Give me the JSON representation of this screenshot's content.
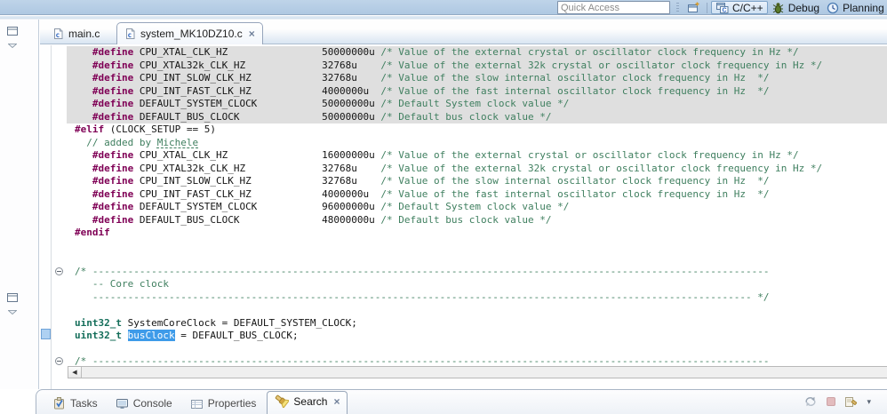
{
  "toolbar": {
    "quick_access": {
      "placeholder": "Quick Access"
    },
    "perspective_buttons": [
      {
        "label": "C/C++",
        "active": true
      },
      {
        "label": "Debug",
        "active": false
      },
      {
        "label": "Planning",
        "active": false
      }
    ]
  },
  "editor_tabs": {
    "items": [
      {
        "label": "main.c",
        "active": false
      },
      {
        "label": "system_MK10DZ10.c",
        "active": true,
        "close": "×"
      }
    ]
  },
  "editor": {
    "lines": [
      {
        "row": 0,
        "inactive": true,
        "t": [
          [
            "p",
            "   "
          ],
          [
            "k",
            "#define"
          ],
          [
            "p",
            " CPU_XTAL_CLK_HZ                50000000u "
          ],
          [
            "c",
            "/* Value of the external crystal or oscillator clock frequency in Hz */"
          ]
        ]
      },
      {
        "row": 1,
        "inactive": true,
        "t": [
          [
            "p",
            "   "
          ],
          [
            "k",
            "#define"
          ],
          [
            "p",
            " CPU_XTAL32k_CLK_HZ             32768u    "
          ],
          [
            "c",
            "/* Value of the external 32k crystal or oscillator clock frequency in Hz */"
          ]
        ]
      },
      {
        "row": 2,
        "inactive": true,
        "t": [
          [
            "p",
            "   "
          ],
          [
            "k",
            "#define"
          ],
          [
            "p",
            " CPU_INT_SLOW_CLK_HZ            32768u    "
          ],
          [
            "c",
            "/* Value of the slow internal oscillator clock frequency in Hz  */"
          ]
        ]
      },
      {
        "row": 3,
        "inactive": true,
        "t": [
          [
            "p",
            "   "
          ],
          [
            "k",
            "#define"
          ],
          [
            "p",
            " CPU_INT_FAST_CLK_HZ            4000000u  "
          ],
          [
            "c",
            "/* Value of the fast internal oscillator clock frequency in Hz  */"
          ]
        ]
      },
      {
        "row": 4,
        "inactive": true,
        "t": [
          [
            "p",
            "   "
          ],
          [
            "k",
            "#define"
          ],
          [
            "p",
            " DEFAULT_SYSTEM_CLOCK           50000000u "
          ],
          [
            "c",
            "/* Default System clock value */"
          ]
        ]
      },
      {
        "row": 5,
        "inactive": true,
        "t": [
          [
            "p",
            "   "
          ],
          [
            "k",
            "#define"
          ],
          [
            "p",
            " DEFAULT_BUS_CLOCK              50000000u "
          ],
          [
            "c",
            "/* Default bus clock value */"
          ]
        ]
      },
      {
        "row": 6,
        "t": [
          [
            "k",
            "#elif"
          ],
          [
            "p",
            " (CLOCK_SETUP == 5)"
          ]
        ]
      },
      {
        "row": 7,
        "t": [
          [
            "p",
            "  "
          ],
          [
            "c",
            "// added by "
          ],
          [
            "cu",
            "Michele"
          ]
        ]
      },
      {
        "row": 8,
        "t": [
          [
            "p",
            "   "
          ],
          [
            "k",
            "#define"
          ],
          [
            "p",
            " CPU_XTAL_CLK_HZ                16000000u "
          ],
          [
            "c",
            "/* Value of the external crystal or oscillator clock frequency in Hz */"
          ]
        ]
      },
      {
        "row": 9,
        "t": [
          [
            "p",
            "   "
          ],
          [
            "k",
            "#define"
          ],
          [
            "p",
            " CPU_XTAL32k_CLK_HZ             32768u    "
          ],
          [
            "c",
            "/* Value of the external 32k crystal or oscillator clock frequency in Hz */"
          ]
        ]
      },
      {
        "row": 10,
        "t": [
          [
            "p",
            "   "
          ],
          [
            "k",
            "#define"
          ],
          [
            "p",
            " CPU_INT_SLOW_CLK_HZ            32768u    "
          ],
          [
            "c",
            "/* Value of the slow internal oscillator clock frequency in Hz  */"
          ]
        ]
      },
      {
        "row": 11,
        "t": [
          [
            "p",
            "   "
          ],
          [
            "k",
            "#define"
          ],
          [
            "p",
            " CPU_INT_FAST_CLK_HZ            4000000u  "
          ],
          [
            "c",
            "/* Value of the fast internal oscillator clock frequency in Hz  */"
          ]
        ]
      },
      {
        "row": 12,
        "t": [
          [
            "p",
            "   "
          ],
          [
            "k",
            "#define"
          ],
          [
            "p",
            " DEFAULT_SYSTEM_CLOCK           96000000u "
          ],
          [
            "c",
            "/* Default System clock value */"
          ]
        ]
      },
      {
        "row": 13,
        "t": [
          [
            "p",
            "   "
          ],
          [
            "k",
            "#define"
          ],
          [
            "p",
            " DEFAULT_BUS_CLOCK              48000000u "
          ],
          [
            "c",
            "/* Default bus clock value */"
          ]
        ]
      },
      {
        "row": 14,
        "t": [
          [
            "k",
            "#endif"
          ]
        ]
      },
      {
        "row": 17,
        "fold": true,
        "t": [
          [
            "c",
            "/* -------------------------------------------------------------------------------------------------------------------"
          ]
        ]
      },
      {
        "row": 18,
        "t": [
          [
            "c",
            "   -- Core clock"
          ]
        ]
      },
      {
        "row": 19,
        "t": [
          [
            "c",
            "   ---------------------------------------------------------------------------------------------------------------- */"
          ]
        ]
      },
      {
        "row": 21,
        "t": [
          [
            "t",
            "uint32_t"
          ],
          [
            "p",
            " SystemCoreClock = DEFAULT_SYSTEM_CLOCK;"
          ]
        ]
      },
      {
        "row": 22,
        "marker": true,
        "t": [
          [
            "t",
            "uint32_t"
          ],
          [
            "p",
            " "
          ],
          [
            "sel",
            "busClock"
          ],
          [
            "p",
            " = DEFAULT_BUS_CLOCK;"
          ]
        ]
      },
      {
        "row": 24,
        "fold": true,
        "t": [
          [
            "c",
            "/* -------------------------------------------------------------------------------------------------------------------"
          ]
        ]
      }
    ]
  },
  "bottom_panel": {
    "tabs": [
      {
        "label": "Tasks",
        "active": false
      },
      {
        "label": "Console",
        "active": false
      },
      {
        "label": "Properties",
        "active": false
      },
      {
        "label": "Search",
        "active": true,
        "close": "×"
      }
    ]
  },
  "icons": {
    "toolbar": [
      "open-perspective-icon",
      "cpp-perspective-icon",
      "debug-icon",
      "planning-icon"
    ],
    "editor_tab": "c-file-icon",
    "left_strip": [
      "restore-view-icon",
      "view-menu-chevron-icon"
    ],
    "editor_margin": [
      "fold-collapse-icon",
      "occurrence-marker"
    ],
    "bottom_tabs": [
      "tasks-icon",
      "console-icon",
      "properties-icon",
      "search-icon"
    ],
    "search_toolbar": [
      "refresh-icon",
      "stop-icon",
      "previous-searches-icon",
      "dropdown-arrow-icon"
    ]
  },
  "colors": {
    "toolbar_bg": "#b9cfe5",
    "inactive_code_bg": "#dfdfdf",
    "keyword": "#7f0055",
    "comment": "#3f7f5f",
    "typedef": "#146e5a",
    "selection_bg": "#3e9be9",
    "selection_text": "#ffffff"
  },
  "scrollbar": {
    "left_arrow": "◀"
  }
}
